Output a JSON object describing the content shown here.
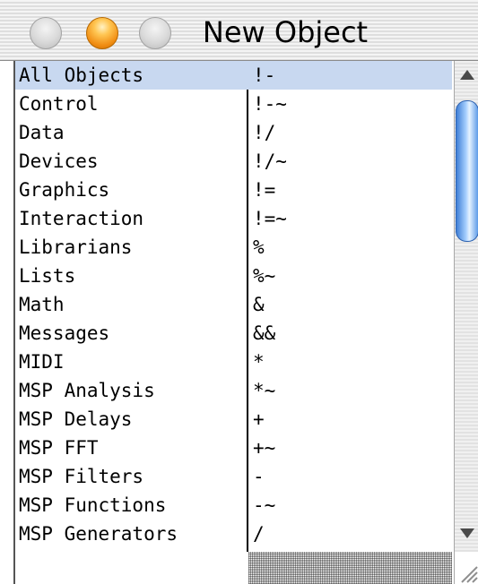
{
  "window": {
    "title": "New Object"
  },
  "rows": [
    {
      "category": "All Objects",
      "object": "!-",
      "selected": true
    },
    {
      "category": "Control",
      "object": "!-~"
    },
    {
      "category": "Data",
      "object": "!/"
    },
    {
      "category": "Devices",
      "object": "!/~"
    },
    {
      "category": "Graphics",
      "object": "!="
    },
    {
      "category": "Interaction",
      "object": "!=~"
    },
    {
      "category": "Librarians",
      "object": "%"
    },
    {
      "category": "Lists",
      "object": "%~"
    },
    {
      "category": "Math",
      "object": "&"
    },
    {
      "category": "Messages",
      "object": "&&"
    },
    {
      "category": "MIDI",
      "object": "*"
    },
    {
      "category": "MSP Analysis",
      "object": "*~"
    },
    {
      "category": "MSP Delays",
      "object": "+"
    },
    {
      "category": "MSP FFT",
      "object": "+~"
    },
    {
      "category": "MSP Filters",
      "object": "-"
    },
    {
      "category": "MSP Functions",
      "object": "-~"
    },
    {
      "category": "MSP Generators",
      "object": "/"
    }
  ],
  "icons": {
    "close": "close-button-icon",
    "minimize": "minimize-button-icon",
    "zoom": "zoom-button-icon",
    "scroll_up": "scroll-up-arrow-icon",
    "scroll_down": "scroll-down-arrow-icon",
    "resize": "resize-grip-icon"
  },
  "colors": {
    "selection": "#c8d8f0",
    "minimize_button": "#f08c12",
    "scroll_thumb": "#5d9be8"
  }
}
